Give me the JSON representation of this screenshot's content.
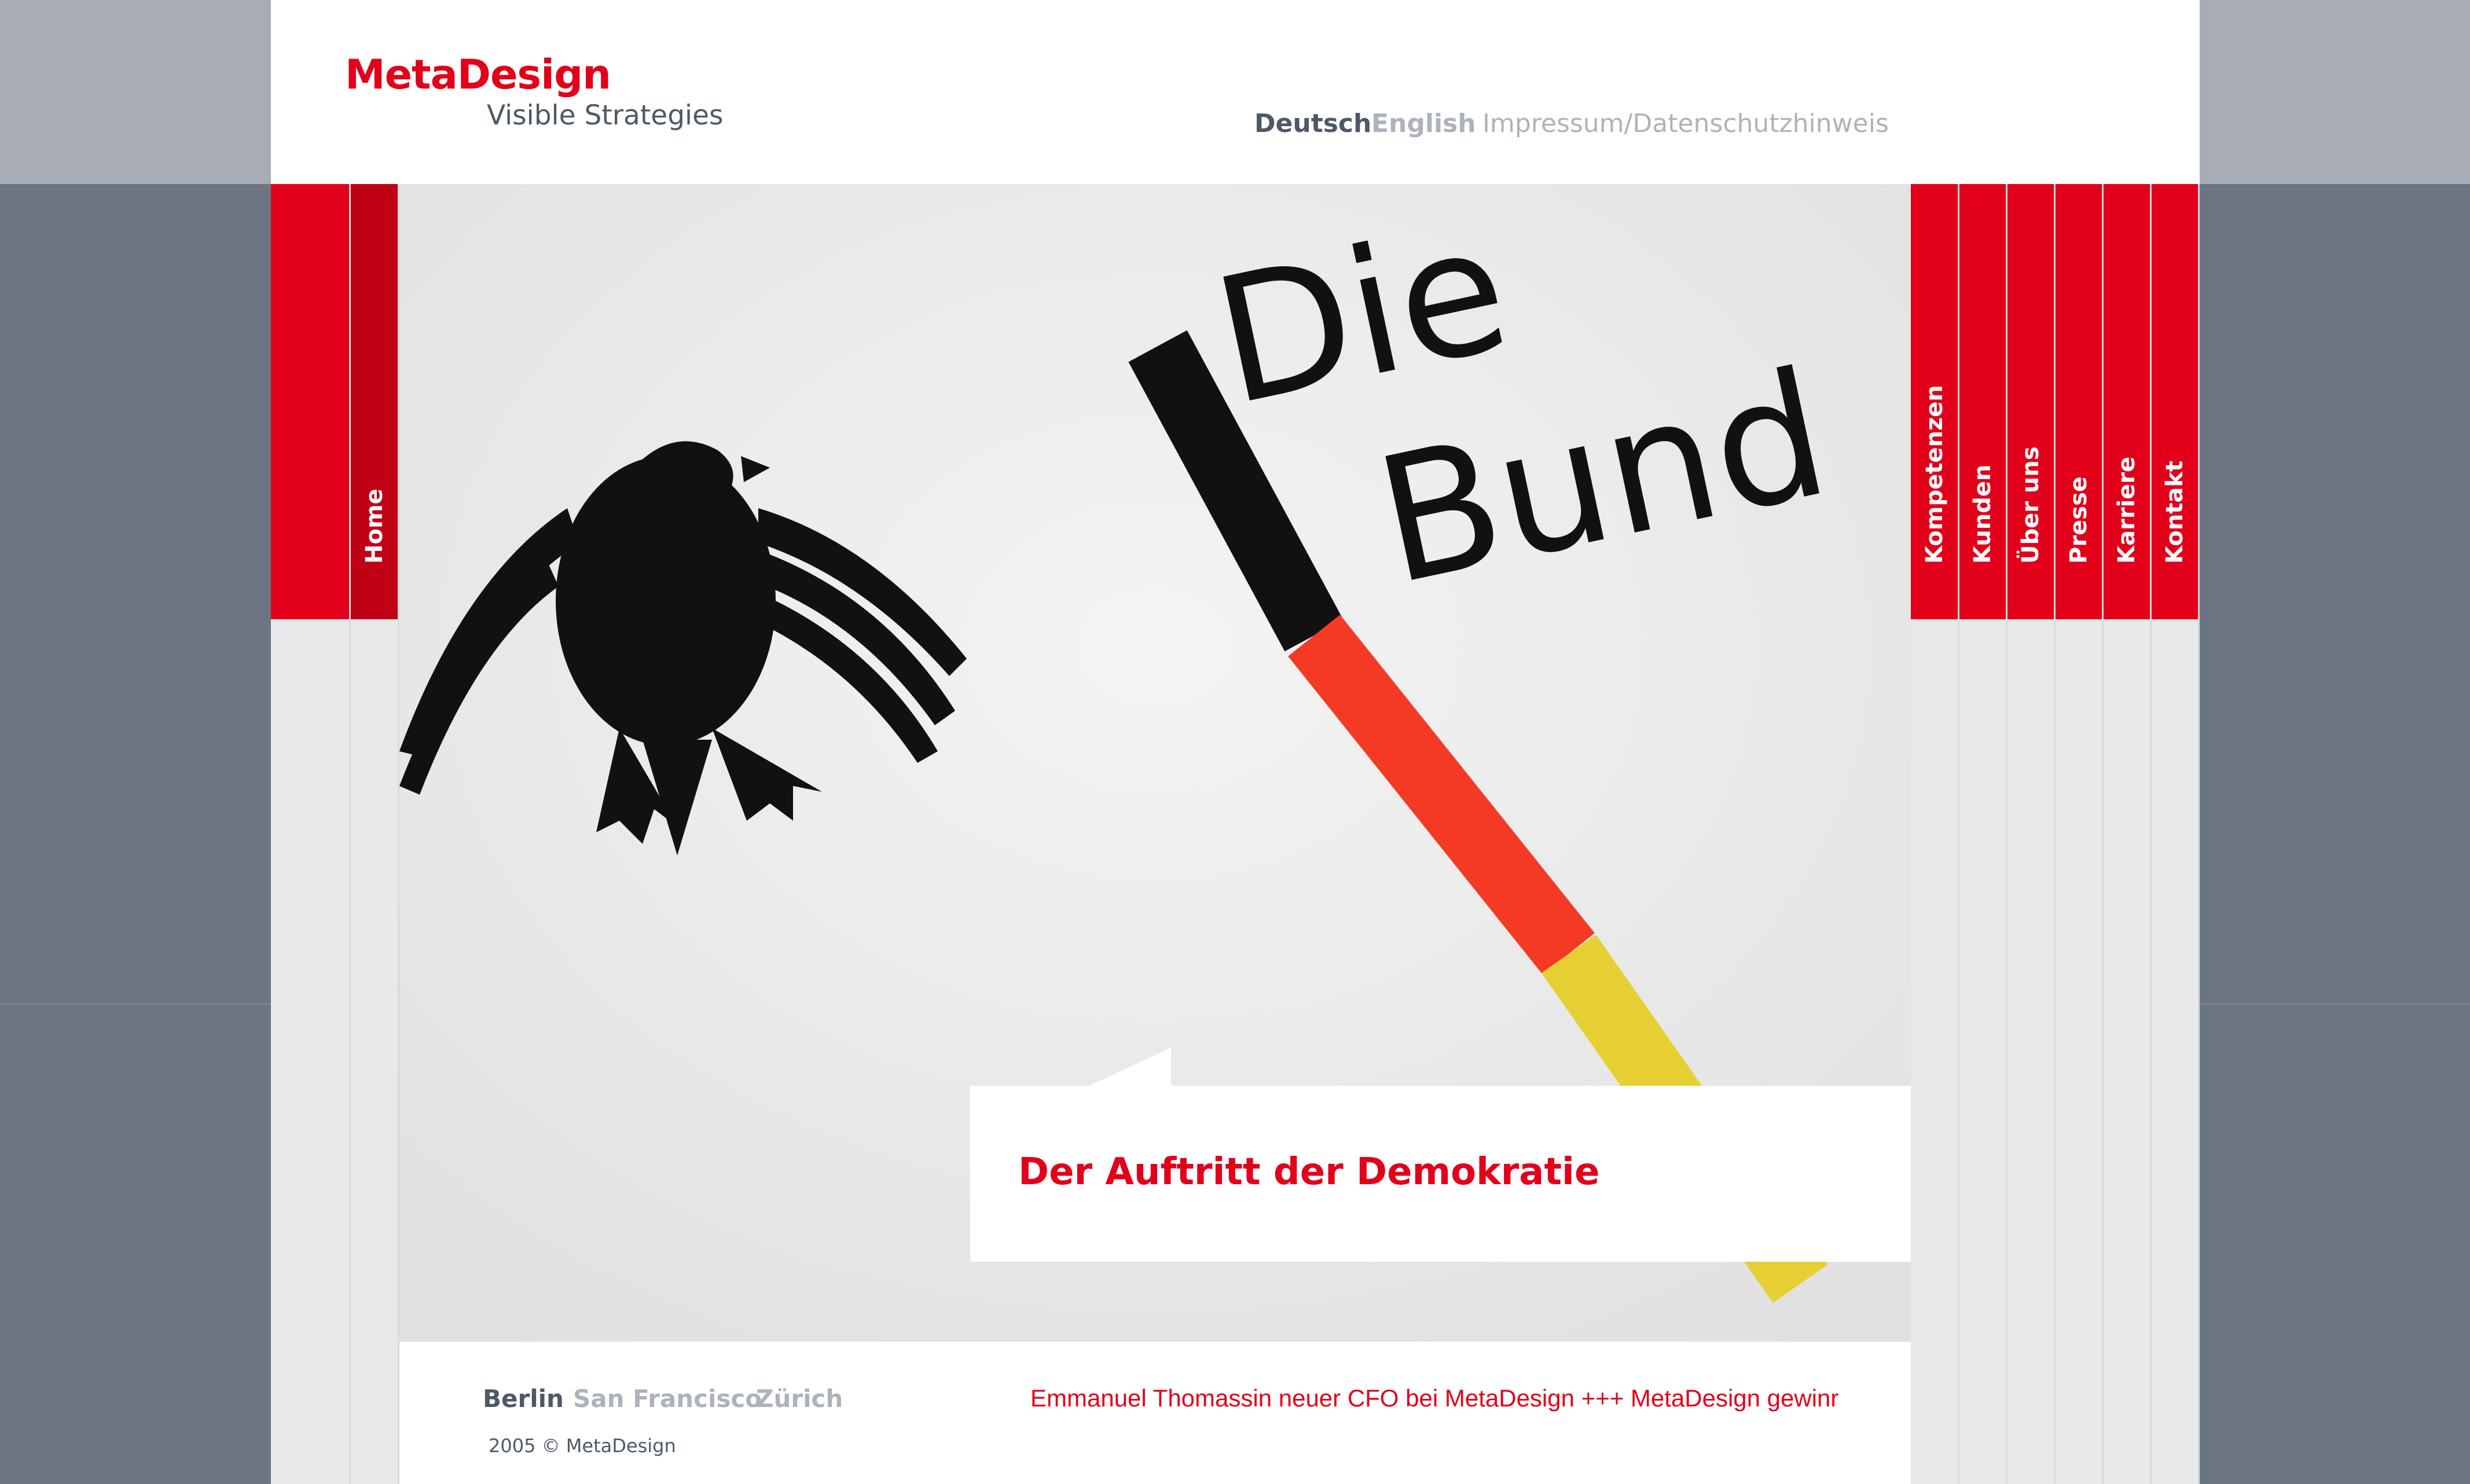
{
  "brand": {
    "name": "MetaDesign",
    "tagline": "Visible Strategies"
  },
  "languages": [
    {
      "label": "Deutsch",
      "active": true
    },
    {
      "label": "English",
      "active": false
    }
  ],
  "imprint_link": "Impressum/Datenschutzhinweis",
  "nav_left": [
    {
      "label": "Home"
    }
  ],
  "nav_right": [
    {
      "label": "Kompetenzen"
    },
    {
      "label": "Kunden"
    },
    {
      "label": "Über uns"
    },
    {
      "label": "Presse"
    },
    {
      "label": "Karriere"
    },
    {
      "label": "Kontakt"
    }
  ],
  "hero": {
    "image_text_line1": "Die",
    "image_text_line2": "Bund",
    "caption": "Der Auftritt der Demokratie"
  },
  "footer": {
    "cities": [
      {
        "label": "Berlin",
        "active": true
      },
      {
        "label": "San Francisco",
        "active": false
      },
      {
        "label": "Zürich",
        "active": false
      }
    ],
    "copyright": "2005 © MetaDesign",
    "ticker": "Emmanuel Thomassin neuer CFO bei MetaDesign +++ MetaDesign gewinr"
  },
  "colors": {
    "brand_red": "#e2001a",
    "dark_text": "#4e5967",
    "muted_text": "#adb3bb",
    "flag_black": "#111111",
    "flag_red": "#f43a24",
    "flag_gold": "#e5cf33"
  }
}
